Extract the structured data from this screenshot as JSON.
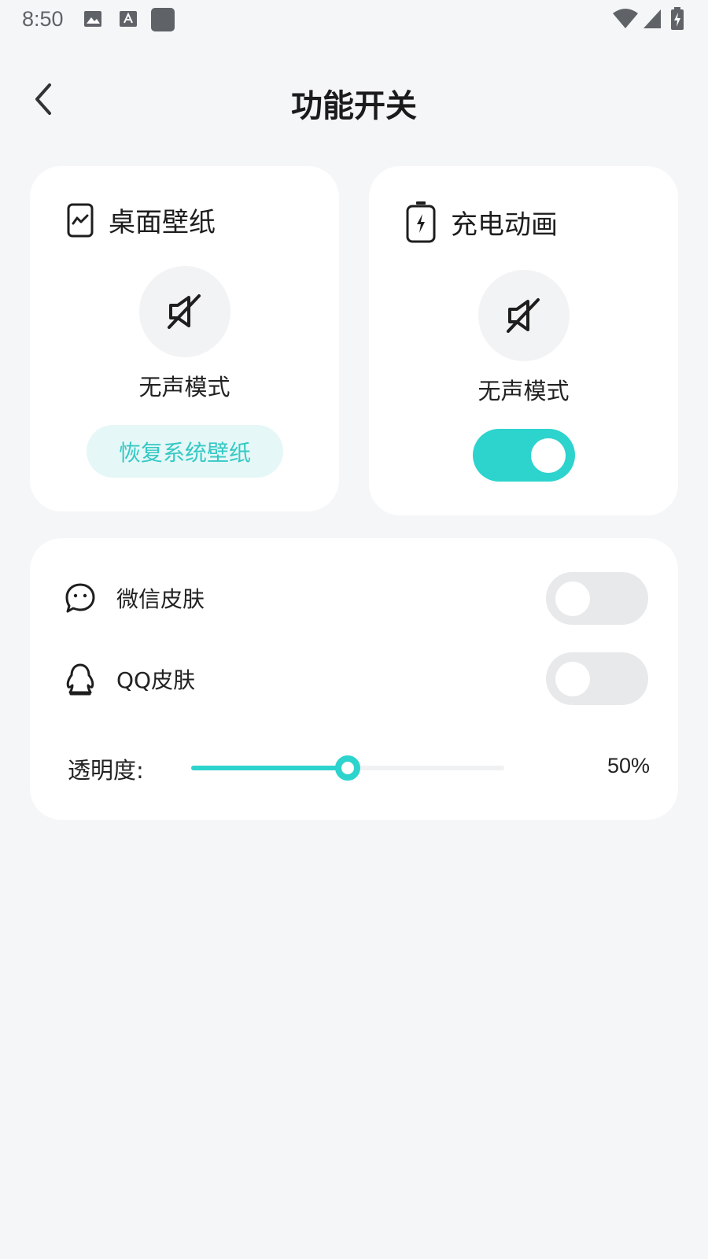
{
  "status_bar": {
    "time": "8:50"
  },
  "header": {
    "title": "功能开关"
  },
  "wallpaper_card": {
    "title": "桌面壁纸",
    "mode_label": "无声模式",
    "restore_button": "恢复系统壁纸"
  },
  "charging_card": {
    "title": "充电动画",
    "mode_label": "无声模式",
    "switch_on": true
  },
  "skins": {
    "wechat": {
      "label": "微信皮肤",
      "switch_on": false
    },
    "qq": {
      "label": "QQ皮肤",
      "switch_on": false
    },
    "opacity": {
      "label": "透明度:",
      "value_text": "50%",
      "fraction": 0.5
    }
  },
  "colors": {
    "accent": "#2dd3cd",
    "background": "#f5f6f8",
    "card": "#ffffff"
  },
  "icons": {
    "back": "chevron-left-icon",
    "wallpaper": "phone-wallpaper-icon",
    "charging": "battery-charging-icon",
    "mute": "speaker-mute-icon",
    "wechat": "chat-bubble-icon",
    "qq": "penguin-icon"
  }
}
